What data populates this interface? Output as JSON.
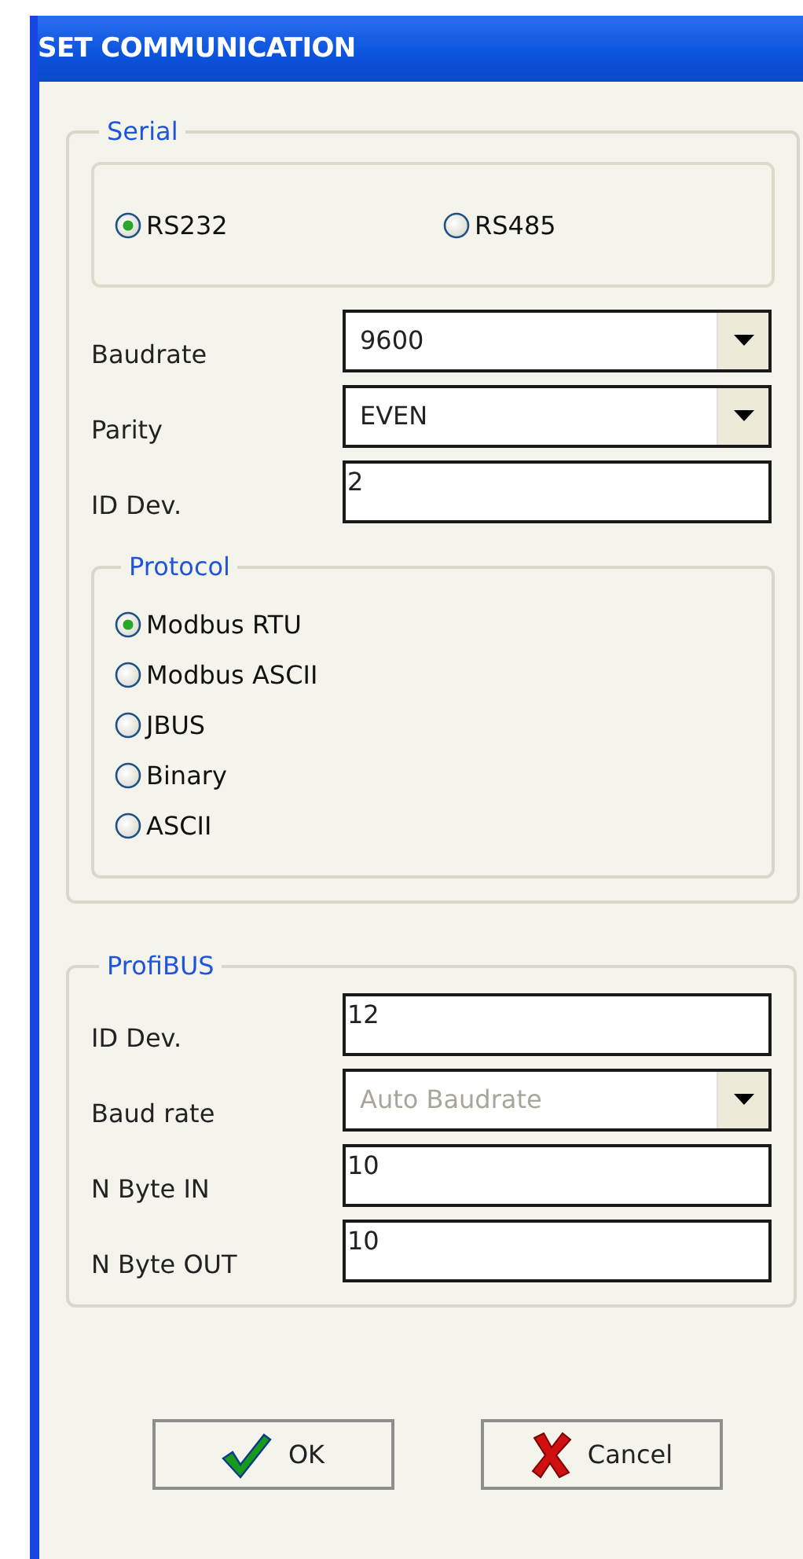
{
  "window": {
    "title": "SET COMMUNICATION"
  },
  "serial": {
    "title": "Serial",
    "ports": [
      {
        "label": "RS232",
        "selected": true
      },
      {
        "label": "RS485",
        "selected": false
      }
    ],
    "fields": [
      {
        "label": "Baudrate",
        "kind": "combo",
        "value": "9600",
        "disabled": false
      },
      {
        "label": "Parity",
        "kind": "combo",
        "value": "EVEN",
        "disabled": false
      },
      {
        "label": "ID Dev.",
        "kind": "text",
        "value": "2",
        "disabled": false
      }
    ],
    "protocol": {
      "title": "Protocol",
      "options": [
        {
          "label": "Modbus RTU",
          "selected": true
        },
        {
          "label": "Modbus ASCII",
          "selected": false
        },
        {
          "label": "JBUS",
          "selected": false
        },
        {
          "label": "Binary",
          "selected": false
        },
        {
          "label": "ASCII",
          "selected": false
        }
      ]
    }
  },
  "profibus": {
    "title": "ProfiBUS",
    "fields": [
      {
        "label": "ID Dev.",
        "kind": "text",
        "value": "12",
        "disabled": false
      },
      {
        "label": "Baud rate",
        "kind": "combo",
        "value": "Auto Baudrate",
        "disabled": true
      },
      {
        "label": "N Byte IN",
        "kind": "text",
        "value": "10",
        "disabled": false
      },
      {
        "label": "N Byte OUT",
        "kind": "text",
        "value": "10",
        "disabled": false
      }
    ]
  },
  "buttons": [
    {
      "label": "OK",
      "kind": "ok"
    },
    {
      "label": "Cancel",
      "kind": "cancel"
    }
  ]
}
